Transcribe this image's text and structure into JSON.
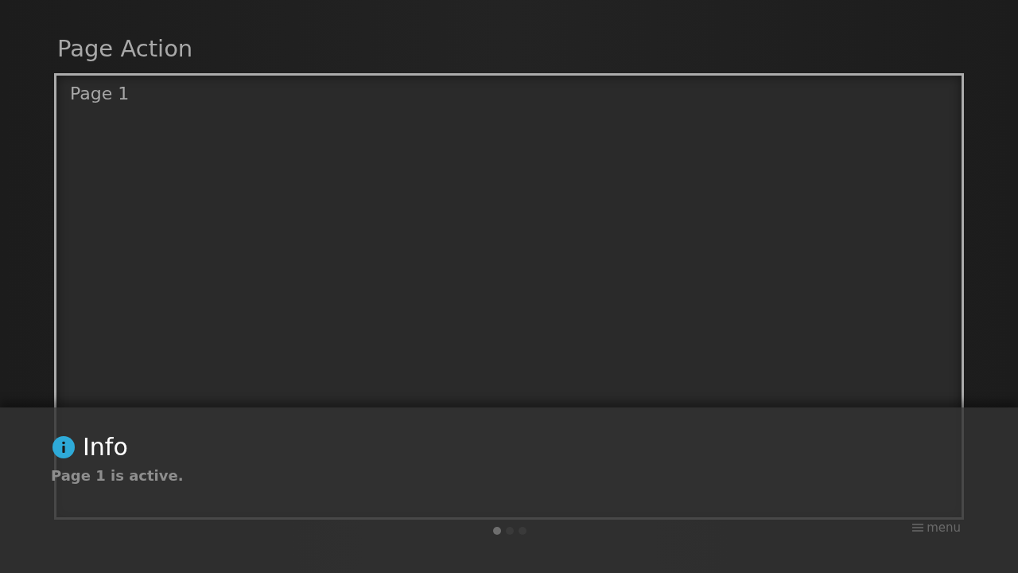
{
  "title": "Page Action",
  "page": {
    "label": "Page 1"
  },
  "info": {
    "title": "Info",
    "message": "Page 1 is active."
  },
  "page_indicator": [
    {
      "selected": true
    },
    {
      "selected": false
    },
    {
      "selected": false
    }
  ],
  "menu": {
    "label": "menu"
  }
}
